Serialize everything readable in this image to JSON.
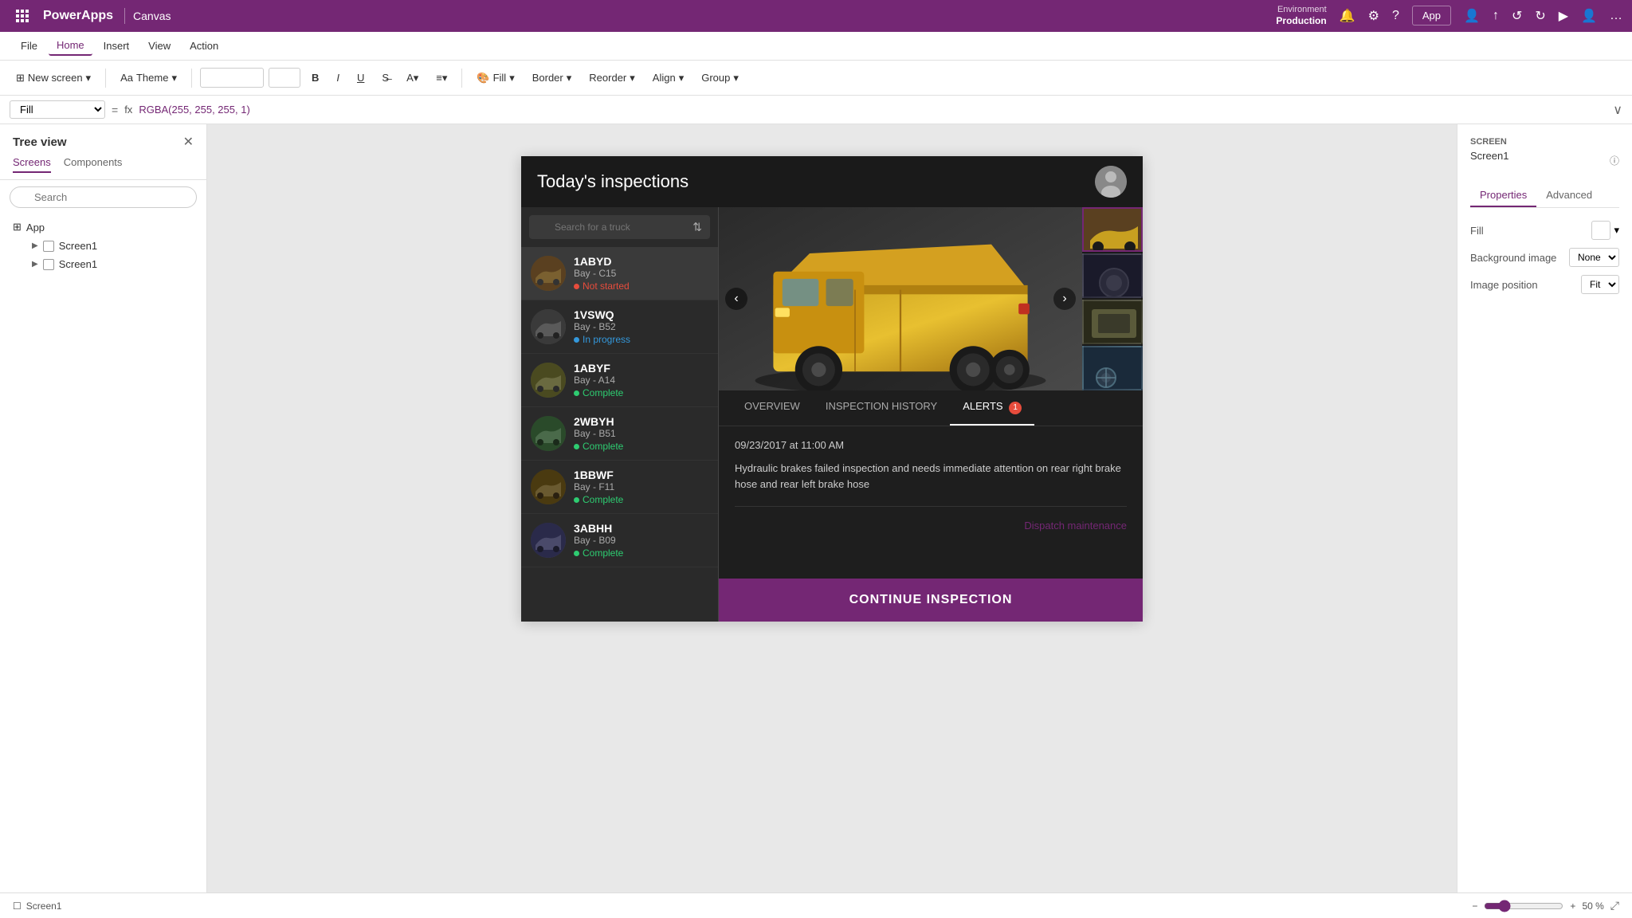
{
  "app": {
    "name": "PowerApps",
    "mode": "Canvas"
  },
  "topbar": {
    "environment_label": "Environment",
    "environment_name": "Production",
    "app_button": "App"
  },
  "menubar": {
    "items": [
      "File",
      "Home",
      "Insert",
      "View",
      "Action"
    ],
    "active": "Home"
  },
  "toolbar": {
    "new_screen_label": "New screen",
    "theme_label": "Theme",
    "bold": "B",
    "italic": "I",
    "underline": "U",
    "fill_label": "Fill",
    "border_label": "Border",
    "reorder_label": "Reorder",
    "align_label": "Align",
    "group_label": "Group"
  },
  "formula_bar": {
    "property": "Fill",
    "equals": "=",
    "func_icon": "fx",
    "value": "RGBA(255, 255, 255, 1)"
  },
  "sidebar": {
    "title": "Tree view",
    "tabs": [
      "Screens",
      "Components"
    ],
    "active_tab": "Screens",
    "search_placeholder": "Search",
    "items": [
      {
        "type": "app",
        "label": "App"
      },
      {
        "type": "screen",
        "label": "Screen1",
        "indent": true
      },
      {
        "type": "screen",
        "label": "Screen1",
        "indent": true
      }
    ]
  },
  "canvas": {
    "app": {
      "header": {
        "title": "Today's inspections"
      },
      "truck_list": {
        "search_placeholder": "Search for a truck",
        "trucks": [
          {
            "id": 1,
            "name": "1ABYD",
            "bay": "Bay - C15",
            "status": "not-started",
            "status_label": "Not started"
          },
          {
            "id": 2,
            "name": "1VSWQ",
            "bay": "Bay - B52",
            "status": "in-progress",
            "status_label": "In progress"
          },
          {
            "id": 3,
            "name": "1ABYF",
            "bay": "Bay - A14",
            "status": "complete",
            "status_label": "Complete"
          },
          {
            "id": 4,
            "name": "2WBYH",
            "bay": "Bay - B51",
            "status": "complete",
            "status_label": "Complete"
          },
          {
            "id": 5,
            "name": "1BBWF",
            "bay": "Bay - F11",
            "status": "complete",
            "status_label": "Complete"
          },
          {
            "id": 6,
            "name": "3ABHH",
            "bay": "Bay - B09",
            "status": "complete",
            "status_label": "Complete"
          }
        ]
      },
      "detail": {
        "tabs": [
          {
            "label": "OVERVIEW",
            "active": false
          },
          {
            "label": "INSPECTION HISTORY",
            "active": false
          },
          {
            "label": "ALERTS",
            "active": true,
            "badge": "1"
          }
        ],
        "date": "09/23/2017 at 11:00 AM",
        "description": "Hydraulic brakes failed inspection and needs immediate attention on rear right brake hose and rear left brake hose",
        "dispatch_label": "Dispatch maintenance",
        "continue_button": "CONTINUE INSPECTION"
      }
    }
  },
  "right_panel": {
    "screen_label": "SCREEN",
    "screen_name": "Screen1",
    "info_icon": "ⓘ",
    "tabs": [
      "Properties",
      "Advanced"
    ],
    "active_tab": "Properties",
    "rows": [
      {
        "label": "Fill",
        "type": "paint"
      },
      {
        "label": "Background image",
        "value": "None"
      },
      {
        "label": "Image position",
        "value": "Fit"
      }
    ]
  },
  "bottombar": {
    "screen_name": "Screen1",
    "zoom_minus": "−",
    "zoom_plus": "+",
    "zoom_value": "50 %"
  }
}
